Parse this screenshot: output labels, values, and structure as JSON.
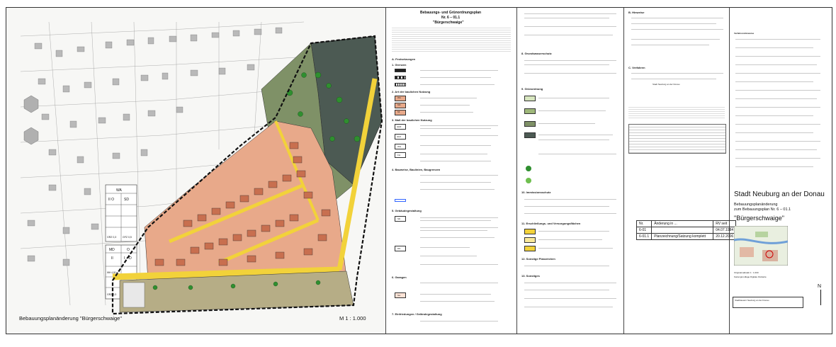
{
  "map": {
    "title": "Bebauungsplanänderung \"Bürgerschwaige\"",
    "scale": "M 1 : 1.000",
    "labels": {
      "wa": "WA",
      "ii_o": "II    O",
      "sd": "SD",
      "gfz": "GRZ 0,3",
      "gfz2": "GFZ 0,5",
      "md": "MD",
      "md_o": "O",
      "md_ii": "II",
      "md_id": "I + D",
      "md_dn": "DN 35°-45°",
      "md_wh": "WH 4,00 m",
      "md_sd": "SD",
      "md_grz": "GRZ 0,3",
      "md_gfz": "GFZ 0,5",
      "anschluss": "Anschluß-Bebauungsplan"
    }
  },
  "legend": {
    "header": "Bebauungs- und Grünordnungsplan",
    "subheader": "Nr. 6 – 01.1",
    "name": "\"Bürgerschwaige\"",
    "section_a": "A.   Festsetzungen",
    "s1": "1.   Grenzen",
    "s2": "2.   Art der baulichen Nutzung",
    "s3": "3.   Maß der baulichen Nutzung",
    "s4": "4.   Bauweise, Baulinien, Baugrenzen",
    "s5": "5.   Gebäudegestaltung",
    "s6": "6.   Garagen",
    "s7": "7.   Einfriedungen / Geländegestaltung",
    "codes": [
      "1.1",
      "1.2",
      "1.3",
      "2.1",
      "2.2",
      "2.3",
      "3.1",
      "3.2",
      "3.3",
      "3.4",
      "3.5",
      "3.6",
      "4.1",
      "4.2",
      "4.3",
      "4.4",
      "5.1",
      "5.2",
      "5.3",
      "6.1",
      "6.2",
      "7.1"
    ],
    "grz": "GRZ",
    "gfz": "GFZ",
    "wh": "WH",
    "fh": "FH",
    "ga": "Ga",
    "sd": "SD",
    "dn": "DN",
    "wa": "WA",
    "md": "MD",
    "mi": "MI"
  },
  "right": {
    "s8": "8.   Grundwasserschutz",
    "s9": "9.   Grünordnung",
    "s10": "10.  Immissionsschutz",
    "s11": "11.  Erschließungs- und Versorgungsflächen",
    "s12": "12.  Sonstige Planzeichen",
    "s13": "13.  Sonstiges",
    "b": "B.   Hinweise",
    "c": "C.   Verfahren",
    "town_small": "Stadt Neuburg an der Donau",
    "verfahrenshinweise": "Verfahrenshinweise"
  },
  "titleblock": {
    "city": "Stadt Neuburg an der Donau",
    "line1": "Bebauungsplanänderung",
    "line2": "zum Bebauungsplan Nr. 6 – 01.1",
    "name": "\"Bürgerschwaige\"",
    "table_head": [
      "Nr.",
      "Änderung in ...",
      "RV seit"
    ],
    "table_rows": [
      [
        "6-01",
        "",
        "04.07.1984"
      ],
      [
        "6-01.1",
        "Planzeichnung/Satzung komplett",
        "20.12.2006"
      ]
    ],
    "orig": "Originalmaßstab  1 : 1.000",
    "grundlage": "Kartengrundlage  Digitale Flurkarte",
    "footer": "Stadtbauamt Neuburg an der Donau",
    "north": "N"
  }
}
